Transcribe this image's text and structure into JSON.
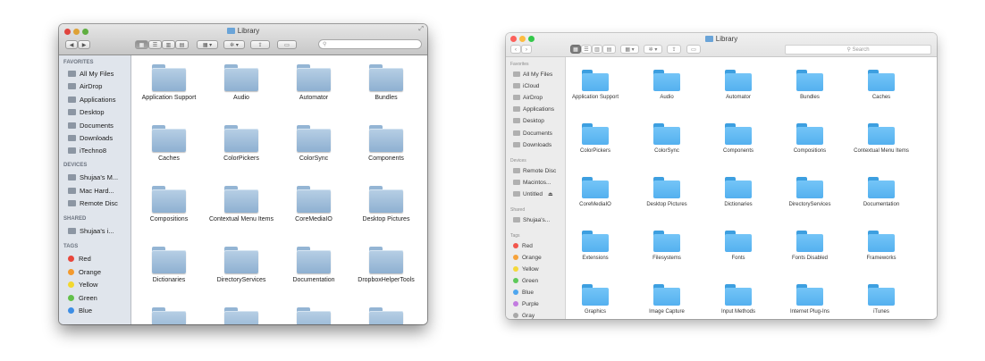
{
  "left_window": {
    "title": "Library",
    "traffic_lights": [
      "#e0443e",
      "#dea236",
      "#5fae40"
    ],
    "sidebar": {
      "favorites_header": "FAVORITES",
      "favorites": [
        {
          "label": "All My Files",
          "icon": "all-files-icon"
        },
        {
          "label": "AirDrop",
          "icon": "airdrop-icon"
        },
        {
          "label": "Applications",
          "icon": "applications-icon"
        },
        {
          "label": "Desktop",
          "icon": "desktop-icon"
        },
        {
          "label": "Documents",
          "icon": "documents-icon"
        },
        {
          "label": "Downloads",
          "icon": "downloads-icon"
        },
        {
          "label": "iTechno8",
          "icon": "home-icon"
        }
      ],
      "devices_header": "DEVICES",
      "devices": [
        {
          "label": "Shujaa's M...",
          "icon": "computer-icon"
        },
        {
          "label": "Mac Hard...",
          "icon": "disk-icon"
        },
        {
          "label": "Remote Disc",
          "icon": "remote-disc-icon"
        }
      ],
      "shared_header": "SHARED",
      "shared": [
        {
          "label": "Shujaa's i...",
          "icon": "shared-computer-icon"
        }
      ],
      "tags_header": "TAGS",
      "tags": [
        {
          "label": "Red",
          "color": "#e8473c"
        },
        {
          "label": "Orange",
          "color": "#f39a2e"
        },
        {
          "label": "Yellow",
          "color": "#f2d82f"
        },
        {
          "label": "Green",
          "color": "#62c04a"
        },
        {
          "label": "Blue",
          "color": "#3d8ee5"
        }
      ]
    },
    "folders": [
      "Application Support",
      "Audio",
      "Automator",
      "Bundles",
      "Caches",
      "ColorPickers",
      "ColorSync",
      "Components",
      "Compositions",
      "Contextual Menu Items",
      "CoreMediaIO",
      "Desktop Pictures",
      "Dictionaries",
      "DirectoryServices",
      "Documentation",
      "DropboxHelperTools",
      "",
      "",
      "",
      ""
    ]
  },
  "right_window": {
    "title": "Library",
    "traffic_lights": [
      "#fc605b",
      "#fdbc40",
      "#34c84a"
    ],
    "search_placeholder": "Search",
    "sidebar": {
      "favorites_header": "Favorites",
      "favorites": [
        {
          "label": "All My Files",
          "icon": "all-files-icon"
        },
        {
          "label": "iCloud",
          "icon": "icloud-icon"
        },
        {
          "label": "AirDrop",
          "icon": "airdrop-icon"
        },
        {
          "label": "Applications",
          "icon": "applications-icon"
        },
        {
          "label": "Desktop",
          "icon": "desktop-icon"
        },
        {
          "label": "Documents",
          "icon": "documents-icon"
        },
        {
          "label": "Downloads",
          "icon": "downloads-icon"
        }
      ],
      "devices_header": "Devices",
      "devices": [
        {
          "label": "Remote Disc",
          "icon": "remote-disc-icon"
        },
        {
          "label": "Macintos...",
          "icon": "disk-icon"
        },
        {
          "label": "Untitled",
          "icon": "untitled-disk-icon"
        }
      ],
      "eject_glyph": "⏏",
      "shared_header": "Shared",
      "shared": [
        {
          "label": "Shujaa's...",
          "icon": "shared-computer-icon"
        }
      ],
      "tags_header": "Tags",
      "tags": [
        {
          "label": "Red",
          "color": "#f2564c"
        },
        {
          "label": "Orange",
          "color": "#f6a23a"
        },
        {
          "label": "Yellow",
          "color": "#f4d83b"
        },
        {
          "label": "Green",
          "color": "#5ec95a"
        },
        {
          "label": "Blue",
          "color": "#4ea6ef"
        },
        {
          "label": "Purple",
          "color": "#c27be0"
        },
        {
          "label": "Gray",
          "color": "#a8a8a8"
        }
      ]
    },
    "folders": [
      "Application Support",
      "Audio",
      "Automator",
      "Bundles",
      "Caches",
      "ColorPickers",
      "ColorSync",
      "Components",
      "Compositions",
      "Contextual Menu Items",
      "CoreMediaIO",
      "Desktop Pictures",
      "Dictionaries",
      "DirectoryServices",
      "Documentation",
      "Extensions",
      "Filesystems",
      "Fonts",
      "Fonts Disabled",
      "Frameworks",
      "Graphics",
      "Image Capture",
      "Input Methods",
      "Internet Plug-Ins",
      "iTunes"
    ]
  }
}
